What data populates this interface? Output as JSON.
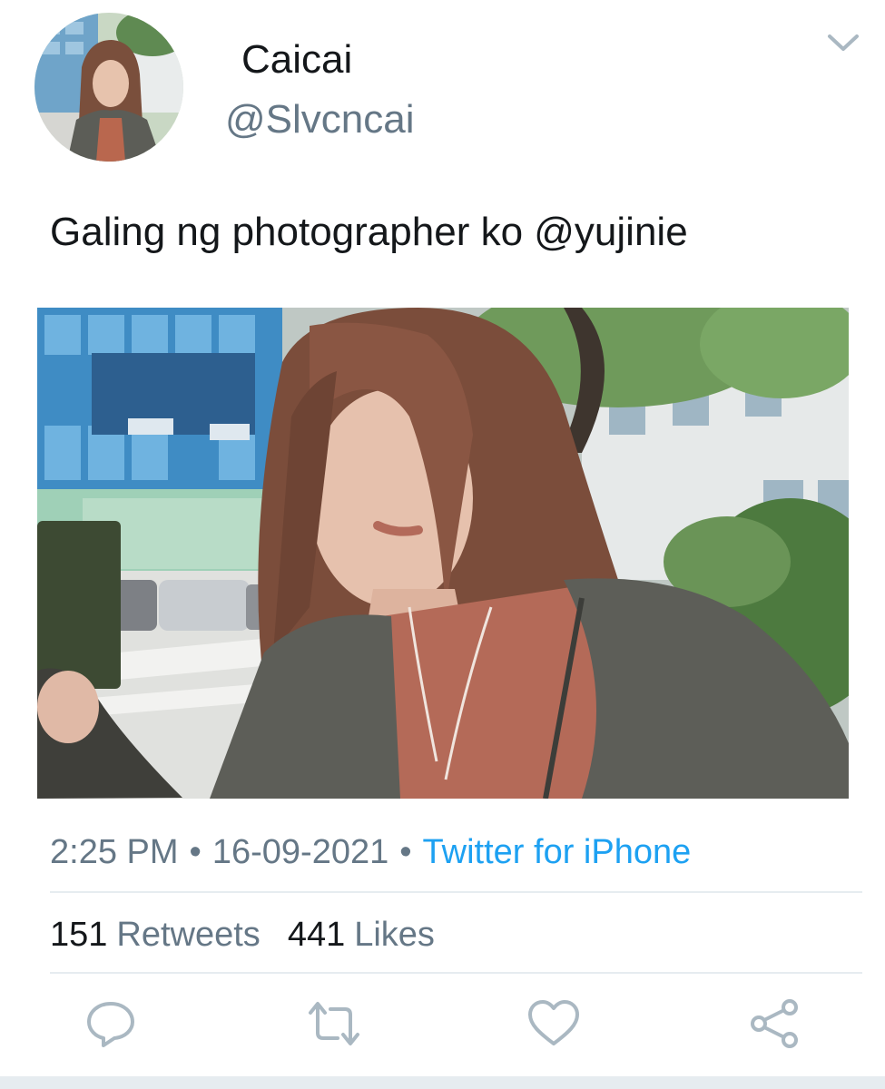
{
  "user": {
    "display_name": "Caicai",
    "handle": "@Slvcncai",
    "avatar_icon": "avatar-photo"
  },
  "tweet": {
    "text_prefix": "Galing ng photographer ko ",
    "mention": "@yujinie",
    "media_icon": "photo"
  },
  "meta": {
    "time": "2:25 PM",
    "separator": "•",
    "date": "16-09-2021",
    "source": "Twitter for iPhone"
  },
  "stats": {
    "retweets_count": "151",
    "retweets_label": "Retweets",
    "likes_count": "441",
    "likes_label": "Likes"
  },
  "actions": {
    "reply_icon": "reply-icon",
    "retweet_icon": "retweet-icon",
    "like_icon": "heart-icon",
    "share_icon": "share-icon"
  },
  "colors": {
    "text_primary": "#14171a",
    "text_secondary": "#657786",
    "link": "#1da1f2",
    "divider": "#e6ecf0"
  }
}
